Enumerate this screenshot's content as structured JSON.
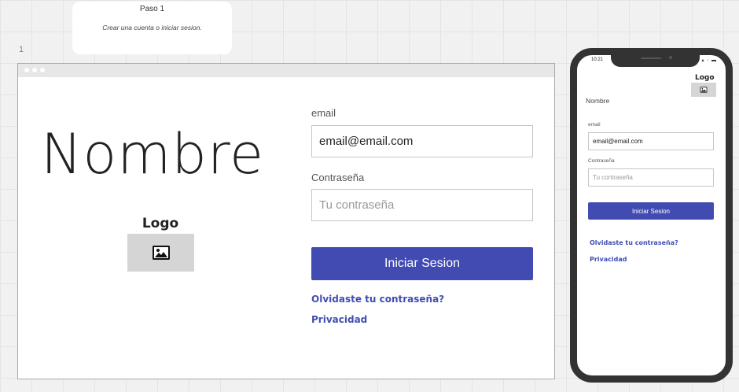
{
  "sticky": {
    "title": "Paso 1",
    "subtitle": "Crear una cuenta o iniciar sesion."
  },
  "frame_number": "1",
  "desktop": {
    "app_name": "Nombre",
    "logo_label": "Logo",
    "email_label": "email",
    "email_value": "email@email.com",
    "password_label": "Contraseña",
    "password_placeholder": "Tu contraseña",
    "login_button": "Iniciar Sesion",
    "forgot_link": "Olvidaste tu contraseña?",
    "privacy_link": "Privacidad"
  },
  "mobile": {
    "status_time": "10:21",
    "status_icons": "▴ ◦ ▬",
    "logo_label": "Logo",
    "app_name": "Nombre",
    "email_label": "email",
    "email_value": "email@email.com",
    "password_label": "Contraseña",
    "password_placeholder": "Tu contraseña",
    "login_button": "Iniciar Sesion",
    "forgot_link": "Olvidaste tu contraseña?",
    "privacy_link": "Privacidad"
  },
  "colors": {
    "accent": "#424bb1",
    "link": "#3f4eb2",
    "logo_placeholder": "#d5d5d5"
  },
  "icons": {
    "logo_placeholder": "image-icon"
  }
}
